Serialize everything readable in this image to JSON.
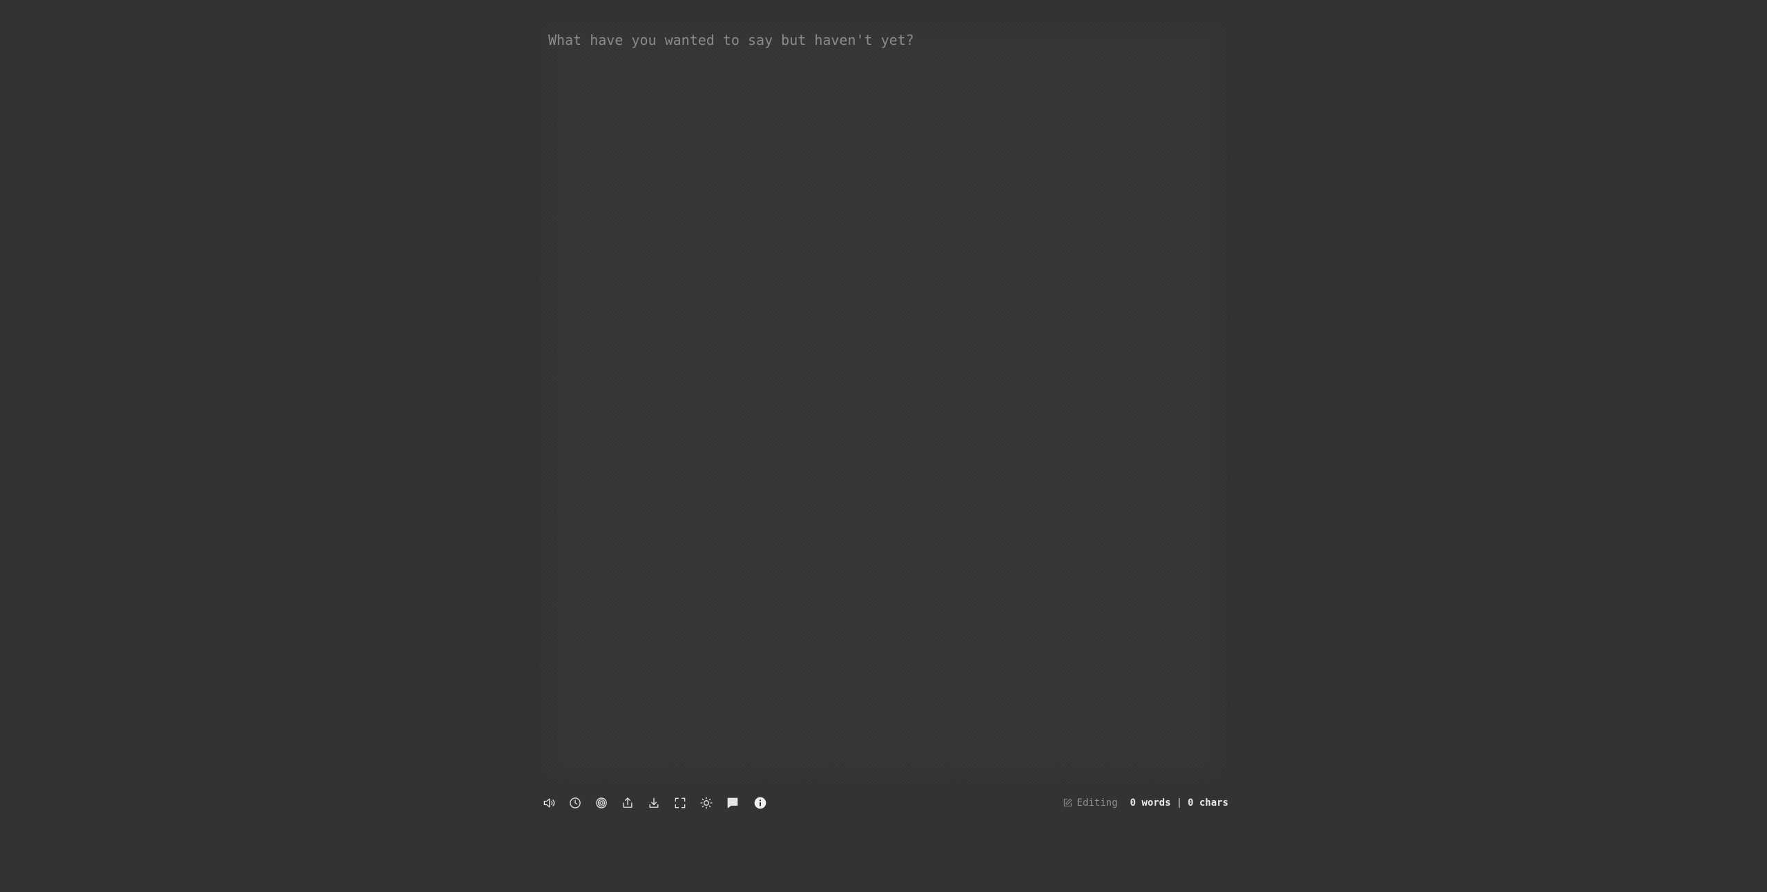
{
  "editor": {
    "placeholder": "What have you wanted to say but haven't yet?",
    "value": ""
  },
  "toolbar": {
    "buttons": [
      {
        "name": "sound-toggle",
        "icon": "speaker-icon"
      },
      {
        "name": "timer",
        "icon": "clock-icon"
      },
      {
        "name": "target",
        "icon": "target-icon"
      },
      {
        "name": "share",
        "icon": "share-icon"
      },
      {
        "name": "download",
        "icon": "download-icon"
      },
      {
        "name": "fullscreen",
        "icon": "fullscreen-icon"
      },
      {
        "name": "theme-toggle",
        "icon": "sun-icon"
      },
      {
        "name": "feedback",
        "icon": "chat-bubble-icon"
      },
      {
        "name": "info",
        "icon": "info-icon"
      }
    ]
  },
  "status": {
    "mode_label": "Editing",
    "mode_icon": "pencil-square-icon",
    "words": "0 words",
    "separator": "|",
    "chars": "0 chars"
  },
  "colors": {
    "background": "#333333",
    "surface": "#353535",
    "placeholder": "#8a8a8a",
    "icon": "#e6e6e6",
    "muted": "#8f8f8f"
  }
}
